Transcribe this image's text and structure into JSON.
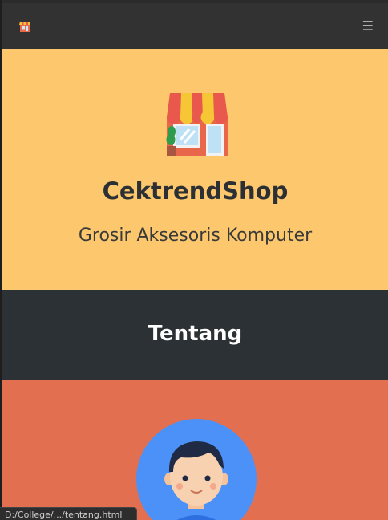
{
  "navbar": {
    "brand_icon": "store-icon",
    "menu_glyph": "☰",
    "menu_icon": "hamburger-menu-icon"
  },
  "hero": {
    "icon": "store-icon",
    "title": "CektrendShop",
    "tagline": "Grosir Aksesoris Komputer"
  },
  "about": {
    "title": "Tentang"
  },
  "profile": {
    "avatar_icon": "user-avatar-icon"
  },
  "status_bar": {
    "url": "D:/College/.../tentang.html"
  },
  "colors": {
    "navbar": "#323232",
    "hero_bg": "#fdc86d",
    "about_bg": "#2b3134",
    "profile_bg": "#e36f51",
    "avatar_bg": "#4b91f7"
  }
}
